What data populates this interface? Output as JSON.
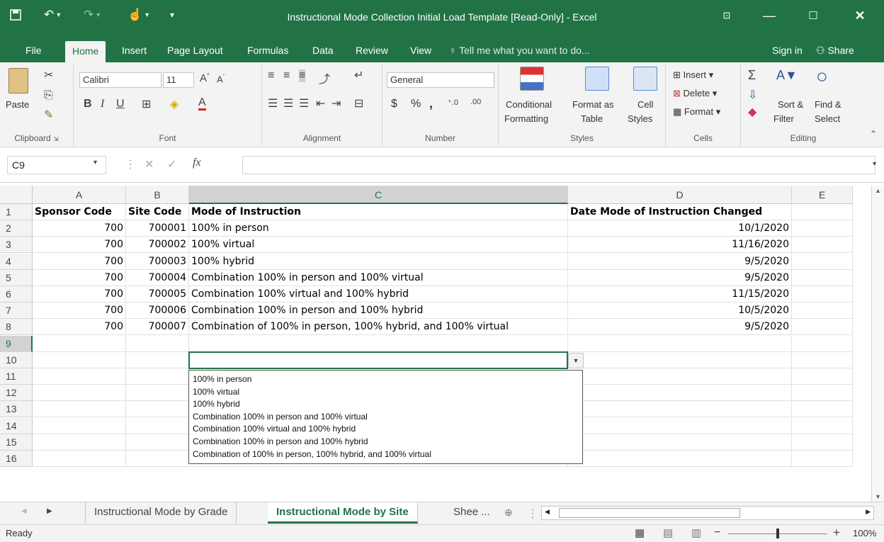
{
  "window": {
    "title": "Instructional Mode Collection Initial Load Template  [Read-Only] - Excel"
  },
  "tabs": {
    "file": "File",
    "home": "Home",
    "insert": "Insert",
    "page_layout": "Page Layout",
    "formulas": "Formulas",
    "data": "Data",
    "review": "Review",
    "view": "View",
    "tell_me": "Tell me what you want to do...",
    "sign_in": "Sign in",
    "share": "Share"
  },
  "ribbon": {
    "clipboard": {
      "label": "Clipboard",
      "paste": "Paste"
    },
    "font": {
      "label": "Font",
      "name": "Calibri",
      "size": "11"
    },
    "alignment": {
      "label": "Alignment"
    },
    "number": {
      "label": "Number",
      "format": "General",
      "currency": "$",
      "percent": "%",
      "comma": ","
    },
    "styles": {
      "label": "Styles",
      "conditional_1": "Conditional",
      "conditional_2": "Formatting",
      "format_as_1": "Format as",
      "format_as_2": "Table",
      "cell_1": "Cell",
      "cell_2": "Styles"
    },
    "cells": {
      "label": "Cells",
      "insert": "Insert",
      "delete": "Delete",
      "format": "Format"
    },
    "editing": {
      "label": "Editing",
      "sort_1": "Sort &",
      "sort_2": "Filter",
      "find_1": "Find &",
      "find_2": "Select"
    }
  },
  "formula_bar": {
    "name_box": "C9",
    "fx": "fx",
    "value": ""
  },
  "columns": [
    "A",
    "B",
    "C",
    "D",
    "E"
  ],
  "rows": [
    "1",
    "2",
    "3",
    "4",
    "5",
    "6",
    "7",
    "8",
    "9",
    "10",
    "11",
    "12",
    "13",
    "14",
    "15",
    "16"
  ],
  "sheet": {
    "header": [
      "Sponsor Code",
      "Site Code",
      "Mode of Instruction",
      "Date Mode of Instruction Changed"
    ],
    "data": [
      [
        "700",
        "700001",
        "100% in person",
        "10/1/2020"
      ],
      [
        "700",
        "700002",
        "100% virtual",
        "11/16/2020"
      ],
      [
        "700",
        "700003",
        "100% hybrid",
        "9/5/2020"
      ],
      [
        "700",
        "700004",
        "Combination 100% in person and 100% virtual",
        "9/5/2020"
      ],
      [
        "700",
        "700005",
        "Combination 100% virtual and 100% hybrid",
        "11/15/2020"
      ],
      [
        "700",
        "700006",
        "Combination 100% in person and 100% hybrid",
        "10/5/2020"
      ],
      [
        "700",
        "700007",
        "Combination of 100% in person, 100% hybrid, and 100% virtual",
        "9/5/2020"
      ]
    ]
  },
  "dropdown": {
    "options": [
      "100% in person",
      "100% virtual",
      "100% hybrid",
      "Combination 100% in person and 100% virtual",
      "Combination 100% virtual and 100% hybrid",
      "Combination 100% in person and 100% hybrid",
      "Combination of 100% in person, 100% hybrid, and 100% virtual"
    ]
  },
  "sheet_tabs": [
    "Instructional Mode by Grade",
    "Instructional Mode by Site",
    "Shee ..."
  ],
  "status": {
    "text": "Ready",
    "zoom": "100%"
  },
  "colors": {
    "accent": "#217346"
  }
}
